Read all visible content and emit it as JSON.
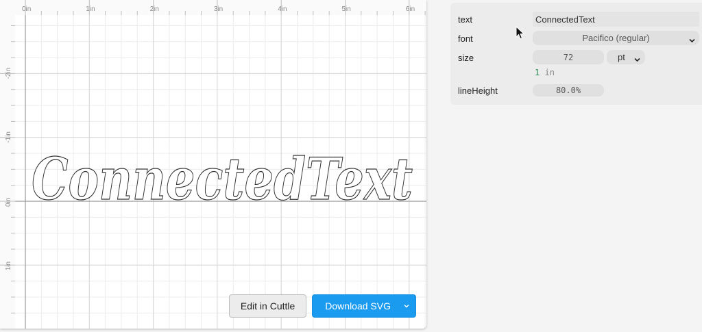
{
  "canvas": {
    "ruler_x_labels": [
      "0in",
      "1in",
      "2in",
      "3in",
      "4in",
      "5in",
      "6in"
    ],
    "ruler_y_labels": [
      "-2in",
      "-1in",
      "0in",
      "1in"
    ],
    "preview_text": "ConnectedText"
  },
  "actions": {
    "edit_label": "Edit in Cuttle",
    "download_label": "Download SVG",
    "download_caret_icon": "chevron-down-icon"
  },
  "params": {
    "text": {
      "label": "text",
      "value": "ConnectedText"
    },
    "font": {
      "label": "font",
      "value": "Pacifico (regular)"
    },
    "size": {
      "label": "size",
      "value": "72",
      "unit": "pt",
      "converted_value": "1",
      "converted_unit": "in"
    },
    "lineHeight": {
      "label": "lineHeight",
      "value": "80.0%"
    }
  },
  "colors": {
    "accent": "#1a9bf0",
    "green_number": "#2e8b57"
  }
}
